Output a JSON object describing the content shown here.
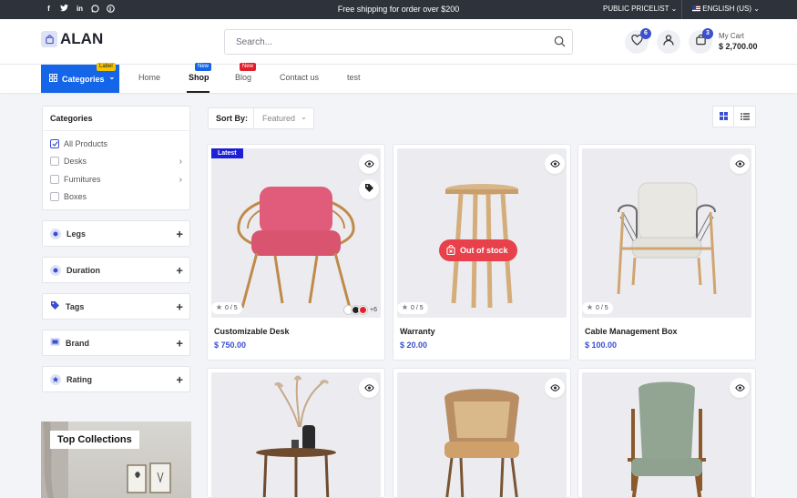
{
  "topbar": {
    "promo": "Free shipping for order over $200",
    "pricelist": "PUBLIC PRICELIST",
    "language": "ENGLISH (US)",
    "socials": [
      "facebook-icon",
      "twitter-icon",
      "linkedin-icon",
      "whatsapp-icon",
      "pinterest-icon"
    ]
  },
  "header": {
    "brand": "ALAN",
    "search_placeholder": "Search...",
    "wishlist_count": "6",
    "cart_count": "3",
    "cart_label": "My Cart",
    "cart_total": "$ 2,700.00"
  },
  "nav": {
    "categories_label": "Categories",
    "categories_tag": "Label",
    "links": [
      {
        "label": "Home"
      },
      {
        "label": "Shop",
        "tag": "New"
      },
      {
        "label": "Blog",
        "tag": "New"
      },
      {
        "label": "Contact us"
      },
      {
        "label": "test"
      }
    ]
  },
  "sidebar": {
    "categories_title": "Categories",
    "categories": [
      {
        "label": "All Products",
        "checked": true
      },
      {
        "label": "Desks",
        "expandable": true
      },
      {
        "label": "Furnitures",
        "expandable": true
      },
      {
        "label": "Boxes"
      }
    ],
    "filters": [
      {
        "label": "Legs",
        "icon": "legs-icon"
      },
      {
        "label": "Duration",
        "icon": "duration-icon"
      },
      {
        "label": "Tags",
        "icon": "tag-icon"
      },
      {
        "label": "Brand",
        "icon": "brand-icon"
      },
      {
        "label": "Rating",
        "icon": "star-icon"
      }
    ],
    "collections_label": "Top Collections"
  },
  "toolbar": {
    "sort_label": "Sort By:",
    "sort_value": "Featured"
  },
  "products": [
    {
      "name": "Customizable Desk",
      "price": "$ 750.00",
      "rating": "0 / 5",
      "badge": "Latest",
      "extra_colors": "+6"
    },
    {
      "name": "Warranty",
      "price": "$ 20.00",
      "rating": "0 / 5",
      "stock": "Out of stock"
    },
    {
      "name": "Cable Management Box",
      "price": "$ 100.00",
      "rating": "0 / 5"
    }
  ],
  "colors": {
    "accent": "#3b4fcf",
    "nav_blue": "#1565e8",
    "out_of_stock": "#e8414b",
    "latest_badge": "#1d1fd6",
    "tag_label": "#f5c400",
    "tag_new_shop": "#1565e8",
    "tag_new_blog": "#e0202a"
  }
}
